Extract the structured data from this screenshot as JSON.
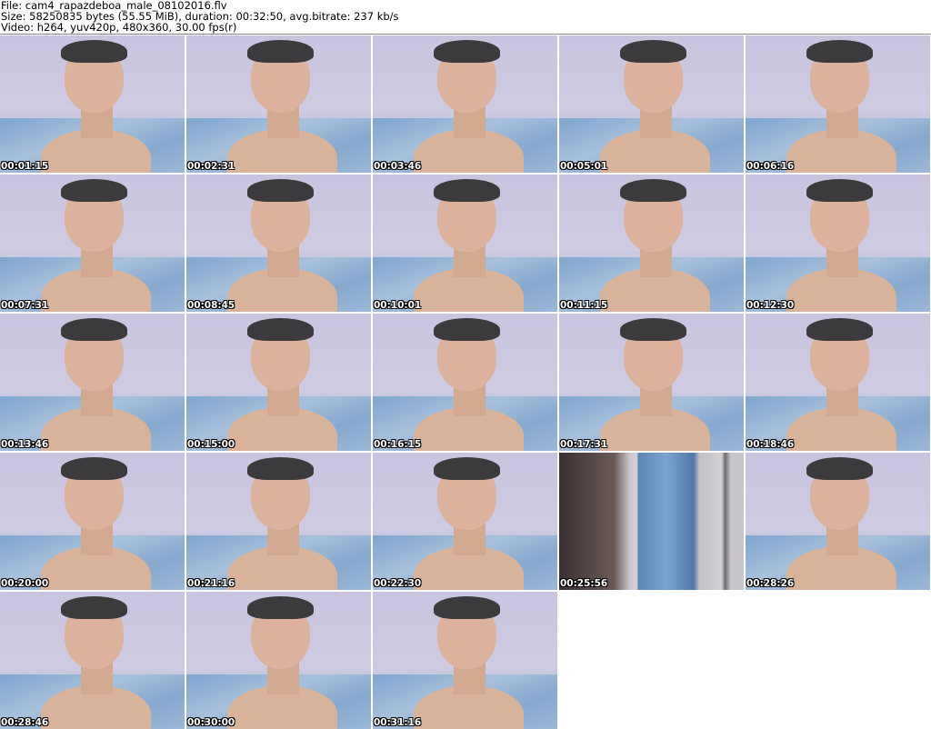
{
  "header": {
    "file_line": "File: cam4_rapazdeboa_male_08102016.flv",
    "size_line": "Size: 58250835 bytes (55.55 MiB), duration: 00:32:50, avg.bitrate: 237 kb/s",
    "video_line": "Video: h264, yuv420p, 480x360, 30.00 fps(r)"
  },
  "thumbnails": [
    {
      "time": "00:01:15"
    },
    {
      "time": "00:02:31"
    },
    {
      "time": "00:03:46"
    },
    {
      "time": "00:05:01"
    },
    {
      "time": "00:06:16"
    },
    {
      "time": "00:07:31"
    },
    {
      "time": "00:08:45"
    },
    {
      "time": "00:10:01"
    },
    {
      "time": "00:11:15"
    },
    {
      "time": "00:12:30"
    },
    {
      "time": "00:13:46"
    },
    {
      "time": "00:15:00"
    },
    {
      "time": "00:16:15"
    },
    {
      "time": "00:17:31"
    },
    {
      "time": "00:18:46"
    },
    {
      "time": "00:20:00"
    },
    {
      "time": "00:21:16"
    },
    {
      "time": "00:22:30"
    },
    {
      "time": "00:25:56",
      "variant": "stripes"
    },
    {
      "time": "00:28:26"
    },
    {
      "time": "00:28:46"
    },
    {
      "time": "00:30:00"
    },
    {
      "time": "00:31:16"
    }
  ]
}
